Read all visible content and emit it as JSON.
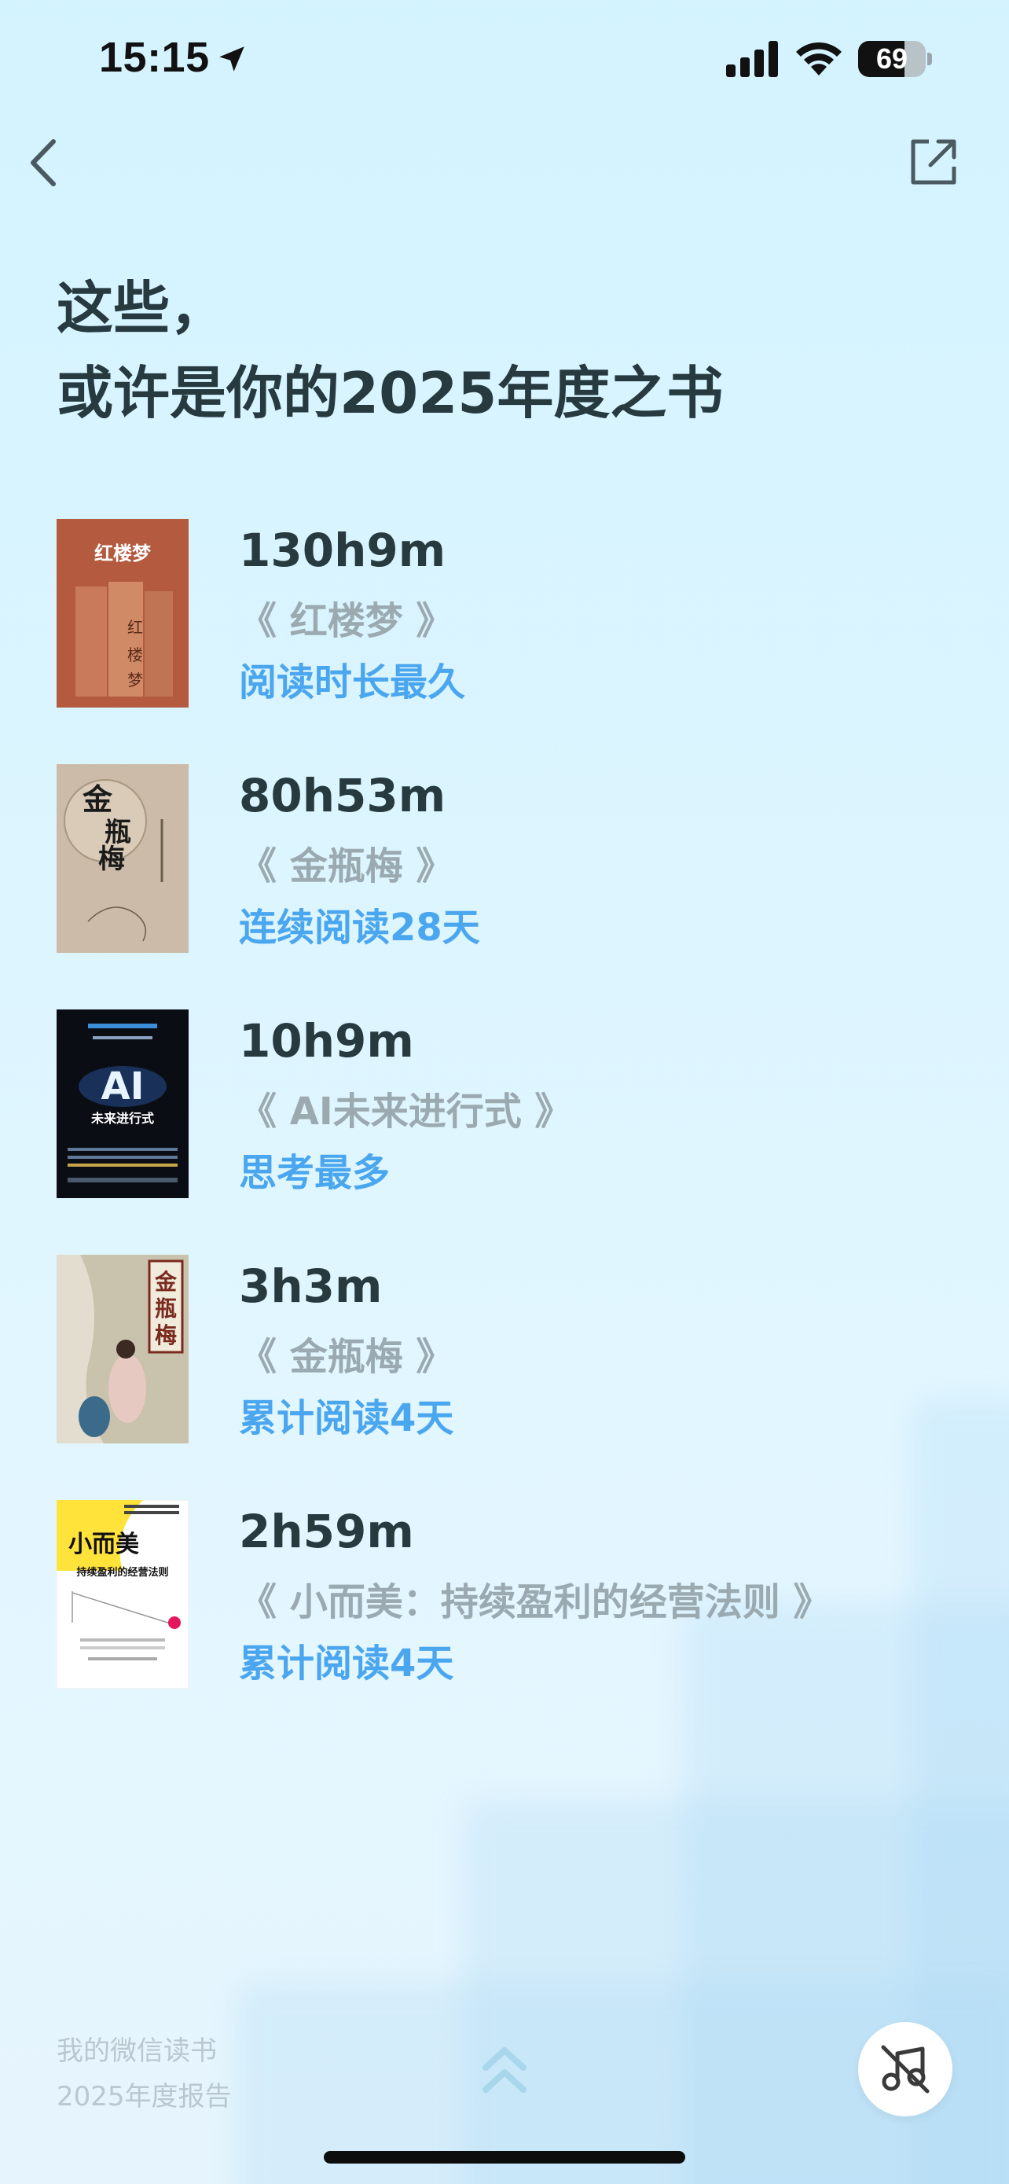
{
  "status_bar": {
    "time": "15:15",
    "battery": "69",
    "battery_level": 0.69
  },
  "title": {
    "line1": "这些，",
    "line2": "或许是你的2025年度之书"
  },
  "books": [
    {
      "time": "130h9m",
      "title": "《 红楼梦 》",
      "label": "阅读时长最久",
      "cover_text": "红楼梦",
      "cover_colors": [
        "#b35a3f",
        "#c87a5a"
      ]
    },
    {
      "time": "80h53m",
      "title": "《 金瓶梅 》",
      "label": "连续阅读28天",
      "cover_text": "金瓶梅",
      "cover_colors": [
        "#cbbba8",
        "#b9a893"
      ]
    },
    {
      "time": "10h9m",
      "title": "《 AI未来进行式 》",
      "label": "思考最多",
      "cover_text": "AI",
      "cover_subtext": "未来进行式",
      "cover_colors": [
        "#0a0d14",
        "#1d2a44"
      ]
    },
    {
      "time": "3h3m",
      "title": "《 金瓶梅 》",
      "label": "累计阅读4天",
      "cover_text": "金瓶梅",
      "cover_colors": [
        "#c9c2ad",
        "#a9a38e"
      ]
    },
    {
      "time": "2h59m",
      "title": "《 小而美：持续盈利的经营法则 》",
      "label": "累计阅读4天",
      "cover_text": "小而美",
      "cover_subtext": "持续盈利的经营法则",
      "cover_colors": [
        "#ffe23a",
        "#ffffff"
      ]
    }
  ],
  "footer": {
    "line1": "我的微信读书",
    "line2": "2025年度报告"
  },
  "icons": {
    "back": "chevron-left-icon",
    "share": "share-external-icon",
    "up": "double-chevron-up-icon",
    "music": "music-off-icon"
  },
  "colors": {
    "text_dark": "#263a40",
    "text_gray": "#9aaab0",
    "accent_blue": "#4aa6ee",
    "bg_light": "#d3f3ff"
  }
}
